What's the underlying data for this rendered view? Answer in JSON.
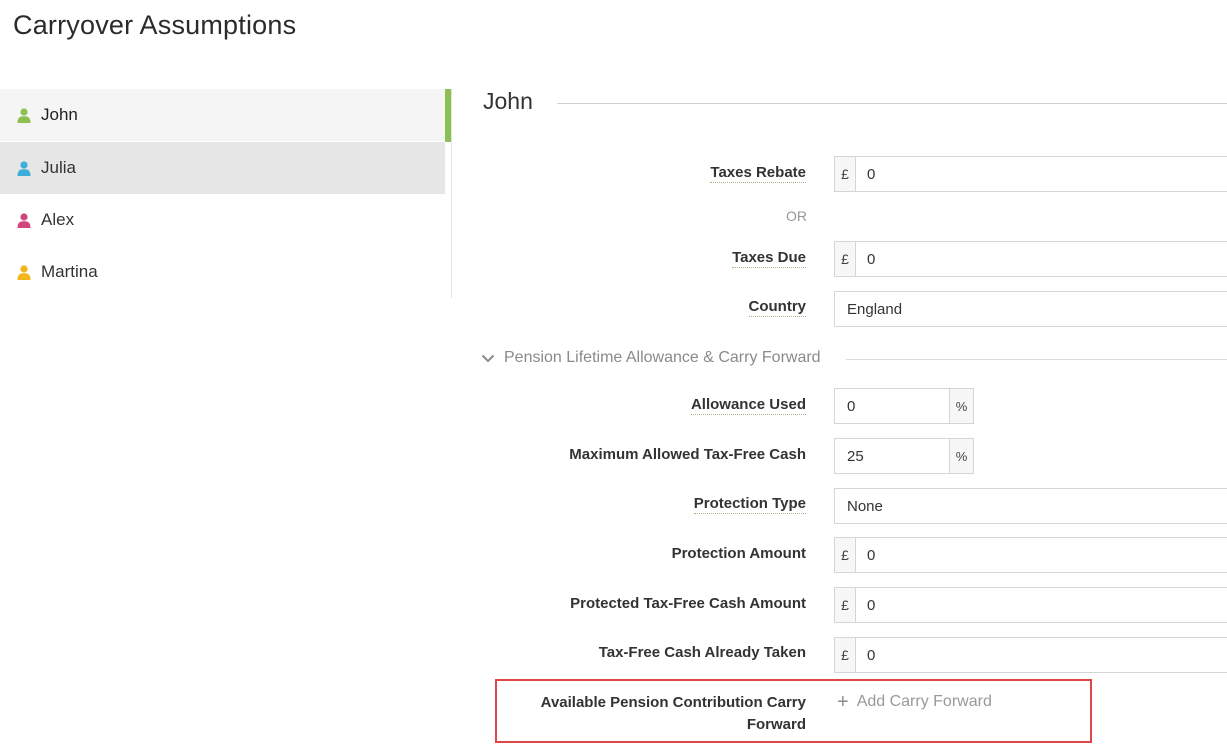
{
  "page": {
    "title": "Carryover Assumptions"
  },
  "sidebar": {
    "people": [
      {
        "name": "John",
        "color": "#8cc152"
      },
      {
        "name": "Julia",
        "color": "#3bafda"
      },
      {
        "name": "Alex",
        "color": "#d0457e"
      },
      {
        "name": "Martina",
        "color": "#f2b61b"
      }
    ],
    "active_color": "#8cc152"
  },
  "main": {
    "person_name": "John",
    "fields": {
      "taxes_rebate": {
        "label": "Taxes Rebate",
        "currency": "£",
        "value": "0"
      },
      "or_text": "OR",
      "taxes_due": {
        "label": "Taxes Due",
        "currency": "£",
        "value": "0"
      },
      "country": {
        "label": "Country",
        "value": "England"
      }
    },
    "pension_section": {
      "title": "Pension Lifetime Allowance & Carry Forward",
      "allowance_used": {
        "label": "Allowance Used",
        "value": "0",
        "unit": "%"
      },
      "max_tax_free_cash": {
        "label": "Maximum Allowed Tax-Free Cash",
        "value": "25",
        "unit": "%"
      },
      "protection_type": {
        "label": "Protection Type",
        "value": "None"
      },
      "protection_amount": {
        "label": "Protection Amount",
        "currency": "£",
        "value": "0"
      },
      "protected_tax_free_cash": {
        "label": "Protected Tax-Free Cash Amount",
        "currency": "£",
        "value": "0"
      },
      "tax_free_cash_taken": {
        "label": "Tax-Free Cash Already Taken",
        "currency": "£",
        "value": "0"
      },
      "carry_forward": {
        "label": "Available Pension Contribution Carry Forward",
        "add_label": "Add Carry Forward"
      }
    }
  },
  "colors": {
    "highlight": "#e04848"
  }
}
